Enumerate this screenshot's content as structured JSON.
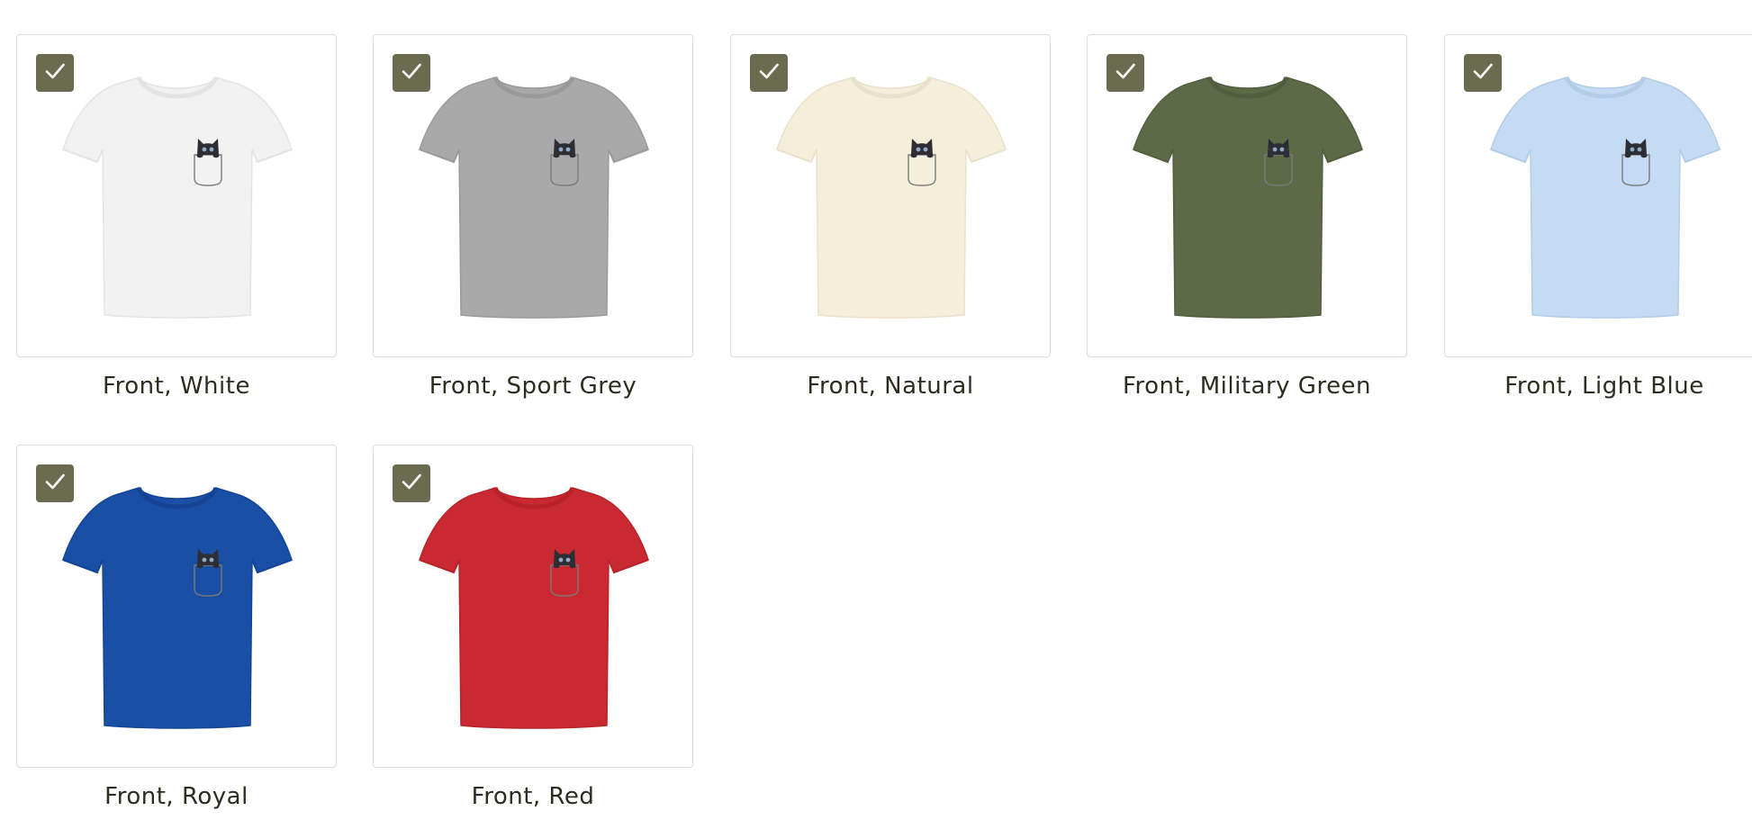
{
  "variants": [
    {
      "label": "Front, White",
      "color": "#f2f2f2",
      "shade": "#e4e4e4",
      "selected": true
    },
    {
      "label": "Front, Sport Grey",
      "color": "#a9a9a9",
      "shade": "#9a9a9a",
      "selected": true
    },
    {
      "label": "Front, Natural",
      "color": "#f5eedb",
      "shade": "#e9e1cb",
      "selected": true
    },
    {
      "label": "Front, Military Green",
      "color": "#5d6a48",
      "shade": "#525e3f",
      "selected": true
    },
    {
      "label": "Front, Light Blue",
      "color": "#c4dbf3",
      "shade": "#b3cde8",
      "selected": true
    },
    {
      "label": "Front, Royal",
      "color": "#1a4fa6",
      "shade": "#154495",
      "selected": true
    },
    {
      "label": "Front, Red",
      "color": "#c92a31",
      "shade": "#b72329",
      "selected": true
    }
  ],
  "checkbox_color": "#6b6b4f",
  "checkbox_icon": "checkmark-icon",
  "print_icon": "black-cat-in-pocket"
}
